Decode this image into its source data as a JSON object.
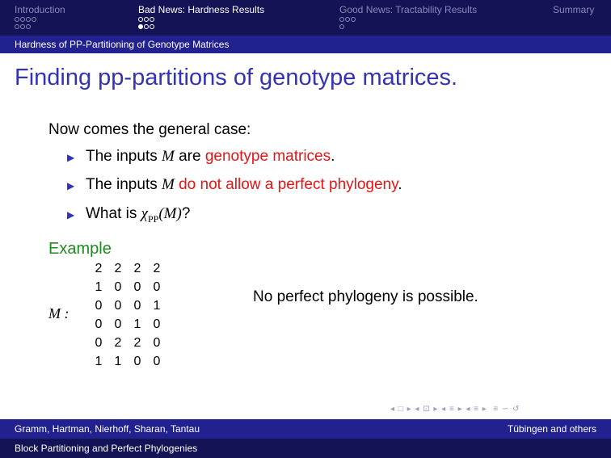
{
  "nav": {
    "sections": [
      {
        "label": "Introduction",
        "dots_rows": [
          4,
          3
        ],
        "active": false
      },
      {
        "label": "Bad News: Hardness Results",
        "dots_rows": [
          3,
          3
        ],
        "active": true
      },
      {
        "label": "Good News: Tractability Results",
        "dots_rows": [
          3,
          1
        ],
        "active": false
      },
      {
        "label": "Summary",
        "dots_rows": [],
        "active": false
      }
    ],
    "subsection": "Hardness of PP-Partitioning of Genotype Matrices"
  },
  "slide": {
    "title": "Finding pp-partitions of genotype matrices.",
    "intro": "Now comes the general case:",
    "bullets": [
      {
        "prefix": "The inputs ",
        "math": "M",
        "mid": " are ",
        "red": "genotype matrices",
        "suffix": "."
      },
      {
        "prefix": "The inputs ",
        "math": "M",
        "mid": " ",
        "red": "do not allow a perfect phylogeny",
        "suffix": "."
      },
      {
        "prefix": "What is ",
        "math": "χ",
        "sub": "PP",
        "math2": "(M)",
        "suffix": "?"
      }
    ],
    "example_title": "Example",
    "matrix_label": "M :",
    "matrix": [
      [
        "2",
        "2",
        "2",
        "2"
      ],
      [
        "1",
        "0",
        "0",
        "0"
      ],
      [
        "0",
        "0",
        "0",
        "1"
      ],
      [
        "0",
        "0",
        "1",
        "0"
      ],
      [
        "0",
        "2",
        "2",
        "0"
      ],
      [
        "1",
        "1",
        "0",
        "0"
      ]
    ],
    "statement": "No perfect phylogeny is possible."
  },
  "footer": {
    "authors": "Gramm, Hartman, Nierhoff, Sharan, Tantau",
    "institute": "Tübingen and others",
    "talk_title": "Block Partitioning and Perfect Phylogenies"
  },
  "colors": {
    "header_dark": "#131356",
    "header_mid": "#21218f",
    "title": "#3333b3",
    "alert": "#e61414",
    "example": "#1f8a1f"
  }
}
